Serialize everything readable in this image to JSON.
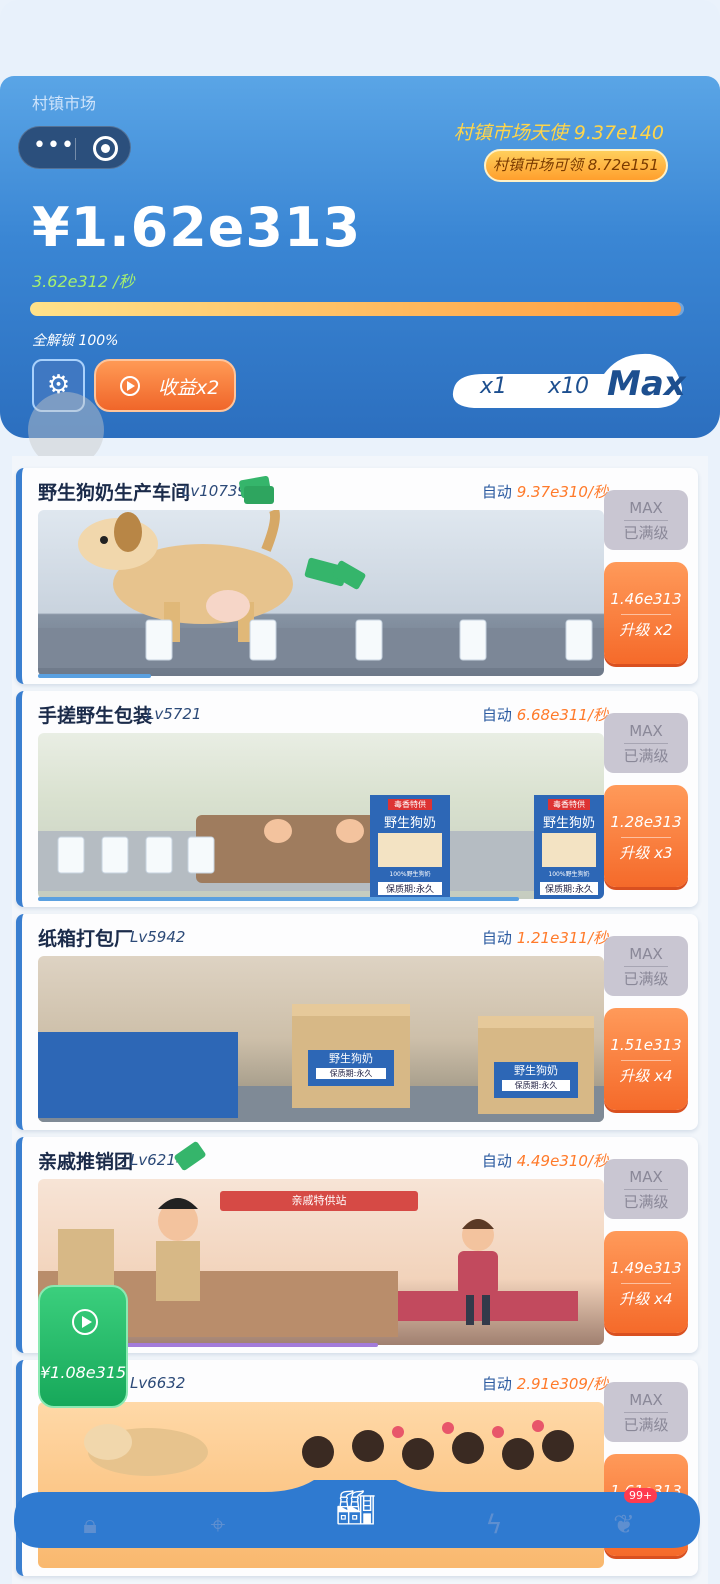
{
  "header": {
    "market_name": "村镇市场",
    "angel": "村镇市场天使 9.37e140",
    "claim": "村镇市场可领 8.72e151",
    "money": "¥1.62e313",
    "rate": "3.62e312 /秒",
    "unlock": "全解锁 100%",
    "progress": 0.995,
    "boost": "收益x2",
    "multipliers": [
      "x1",
      "x10",
      "Max"
    ]
  },
  "items": [
    {
      "title": "野生狗奶生产车间",
      "level": "Lv10739",
      "auto_label": "自动",
      "auto_rate": "9.37e310/秒",
      "max_label": "MAX",
      "max_sub": "已满级",
      "cost": "1.46e313",
      "upgrade": "升级 x2",
      "progress": 0.2
    },
    {
      "title": "手搓野生包装",
      "level": "Lv5721",
      "auto_label": "自动",
      "auto_rate": "6.68e311/秒",
      "max_label": "MAX",
      "max_sub": "已满级",
      "cost": "1.28e313",
      "upgrade": "升级 x3",
      "progress": 0.85,
      "box_label": "野生狗奶",
      "box_top": "毒香特供",
      "box_pct": "100%野生狗奶",
      "box_bottom": "保质期:永久"
    },
    {
      "title": "纸箱打包厂",
      "level": "Lv5942",
      "auto_label": "自动",
      "auto_rate": "1.21e311/秒",
      "max_label": "MAX",
      "max_sub": "已满级",
      "cost": "1.51e313",
      "upgrade": "升级 x4",
      "progress": 0.0,
      "crate_label": "野生狗奶",
      "crate_sub": "保质期:永久"
    },
    {
      "title": "亲戚推销团",
      "level": "Lv6214",
      "auto_label": "自动",
      "auto_rate": "4.49e310/秒",
      "max_label": "MAX",
      "max_sub": "已满级",
      "cost": "1.49e313",
      "upgrade": "升级 x4",
      "progress": 0.6,
      "banner": "亲戚特供站"
    },
    {
      "title": "",
      "level": "Lv6632",
      "auto_label": "自动",
      "auto_rate": "2.91e309/秒",
      "max_label": "MAX",
      "max_sub": "已满级",
      "cost": "1.61e313",
      "upgrade": "",
      "progress": 0.0
    }
  ],
  "float_reward": "¥1.08e315",
  "nav": {
    "badge": "99+",
    "icons": [
      "bag-icon",
      "location-pin-icon",
      "factory-icon",
      "lightning-icon",
      "wings-icon"
    ]
  }
}
